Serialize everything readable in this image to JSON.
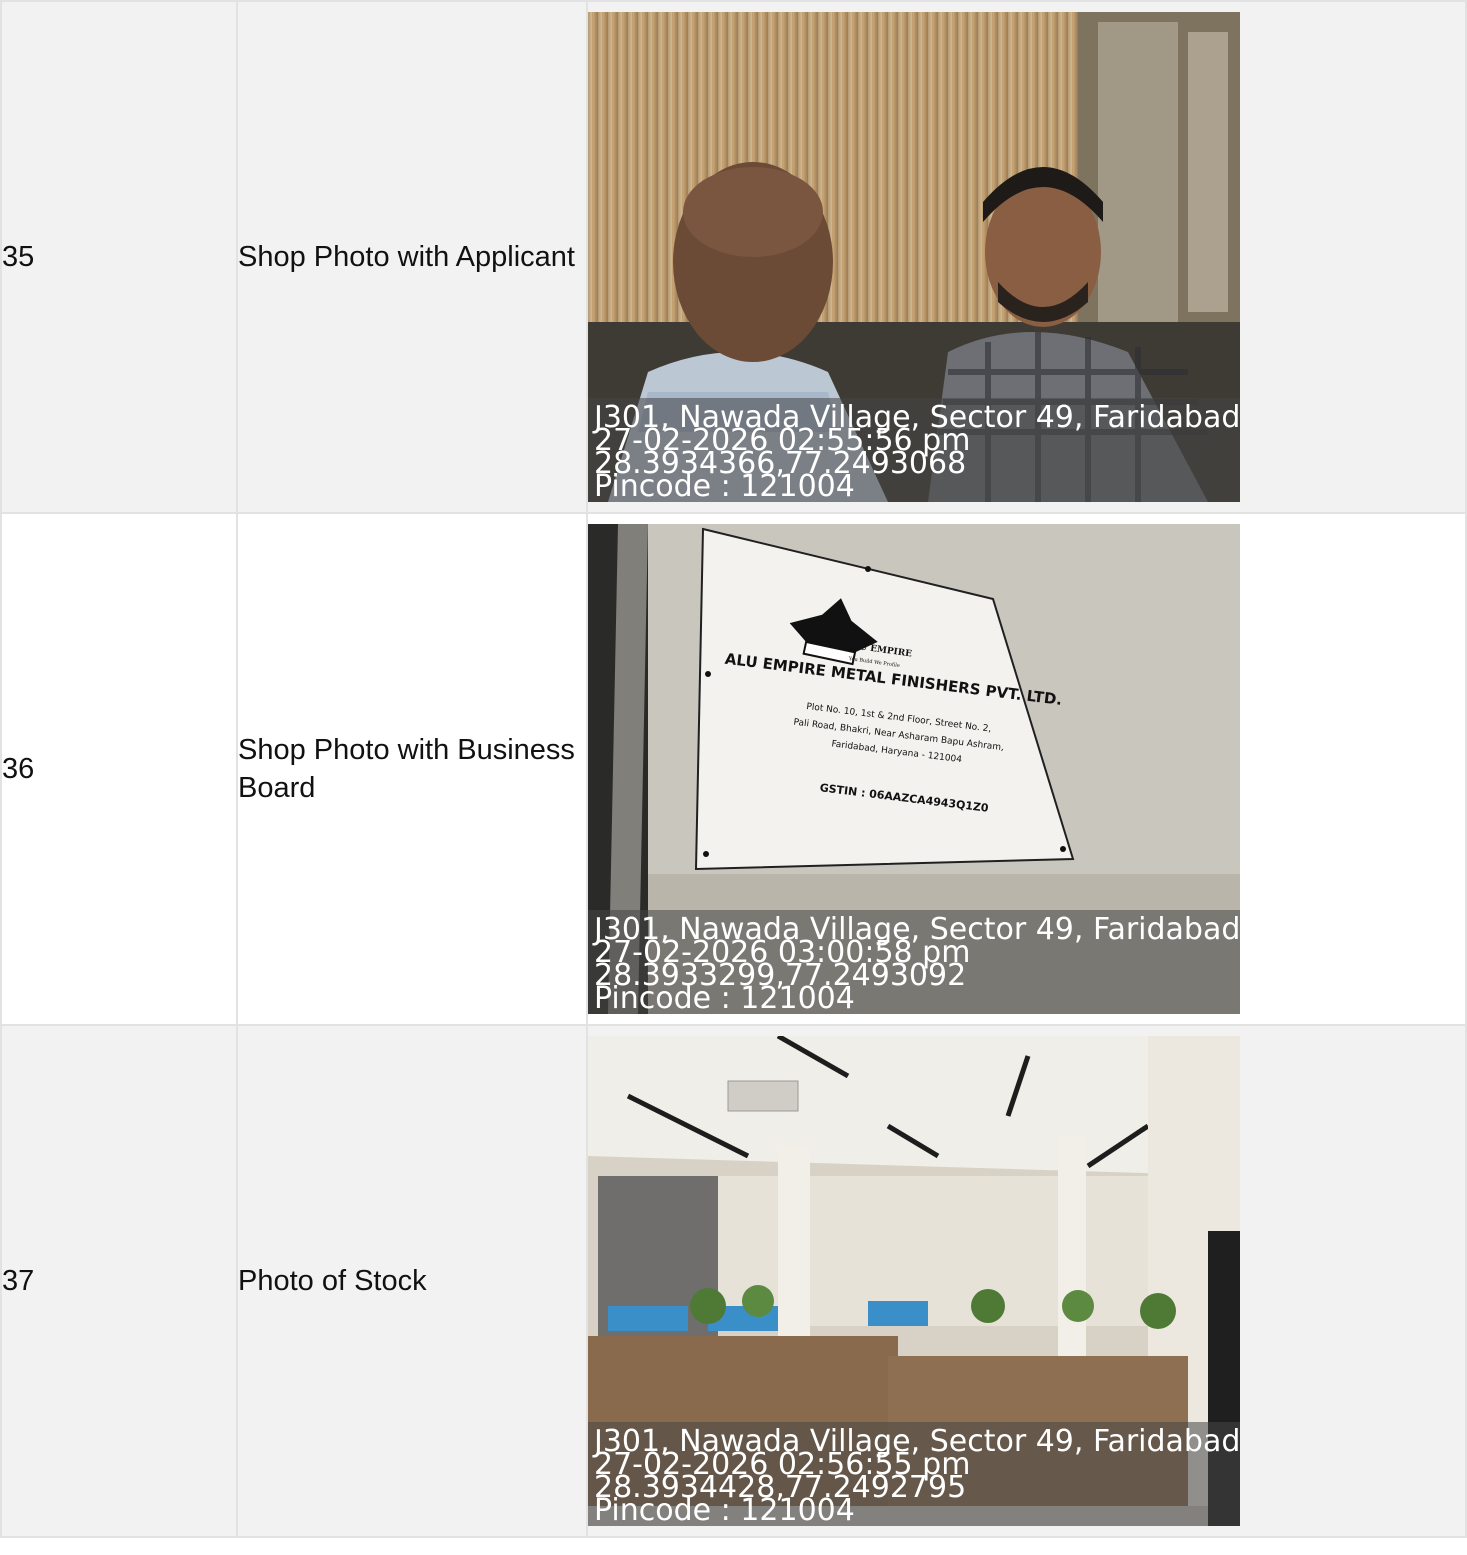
{
  "rows": [
    {
      "no": "35",
      "label": "Shop Photo with Applicant",
      "photo_subject": "selfie-two-men",
      "stamp": {
        "address": "J301, Nawada Village, Sector 49, Faridabad",
        "datetime": "27-02-2026 02:55:56 pm",
        "coords": "28.3934366,77.2493068",
        "pincode": "Pincode : 121004"
      }
    },
    {
      "no": "36",
      "label": "Shop Photo with Business Board",
      "photo_subject": "business-signboard",
      "board": {
        "logo": "ALU EMPIRE",
        "tagline": "You Build We Profile",
        "company": "ALU EMPIRE METAL FINISHERS PVT. LTD.",
        "address_line1": "Plot No. 10, 1st & 2nd Floor, Street No. 2,",
        "address_line2": "Pali Road, Bhakri, Near Asharam Bapu Ashram,",
        "address_line3": "Faridabad, Haryana - 121004",
        "gstin": "GSTIN : 06AAZCA4943Q1Z0"
      },
      "stamp": {
        "address": "J301, Nawada Village, Sector 49, Faridabad",
        "datetime": "27-02-2026 03:00:58 pm",
        "coords": "28.3933299,77.2493092",
        "pincode": "Pincode : 121004"
      }
    },
    {
      "no": "37",
      "label": "Photo of Stock",
      "photo_subject": "office-interior",
      "stamp": {
        "address": "J301, Nawada Village, Sector 49, Faridabad",
        "datetime": "27-02-2026 02:56:55 pm",
        "coords": "28.3934428,77.2492795",
        "pincode": "Pincode : 121004"
      }
    }
  ],
  "colors": {
    "row_shade": "#f2f2f2",
    "border": "#e2e2e2",
    "stamp_bg": "rgba(70,70,70,0.55)"
  }
}
